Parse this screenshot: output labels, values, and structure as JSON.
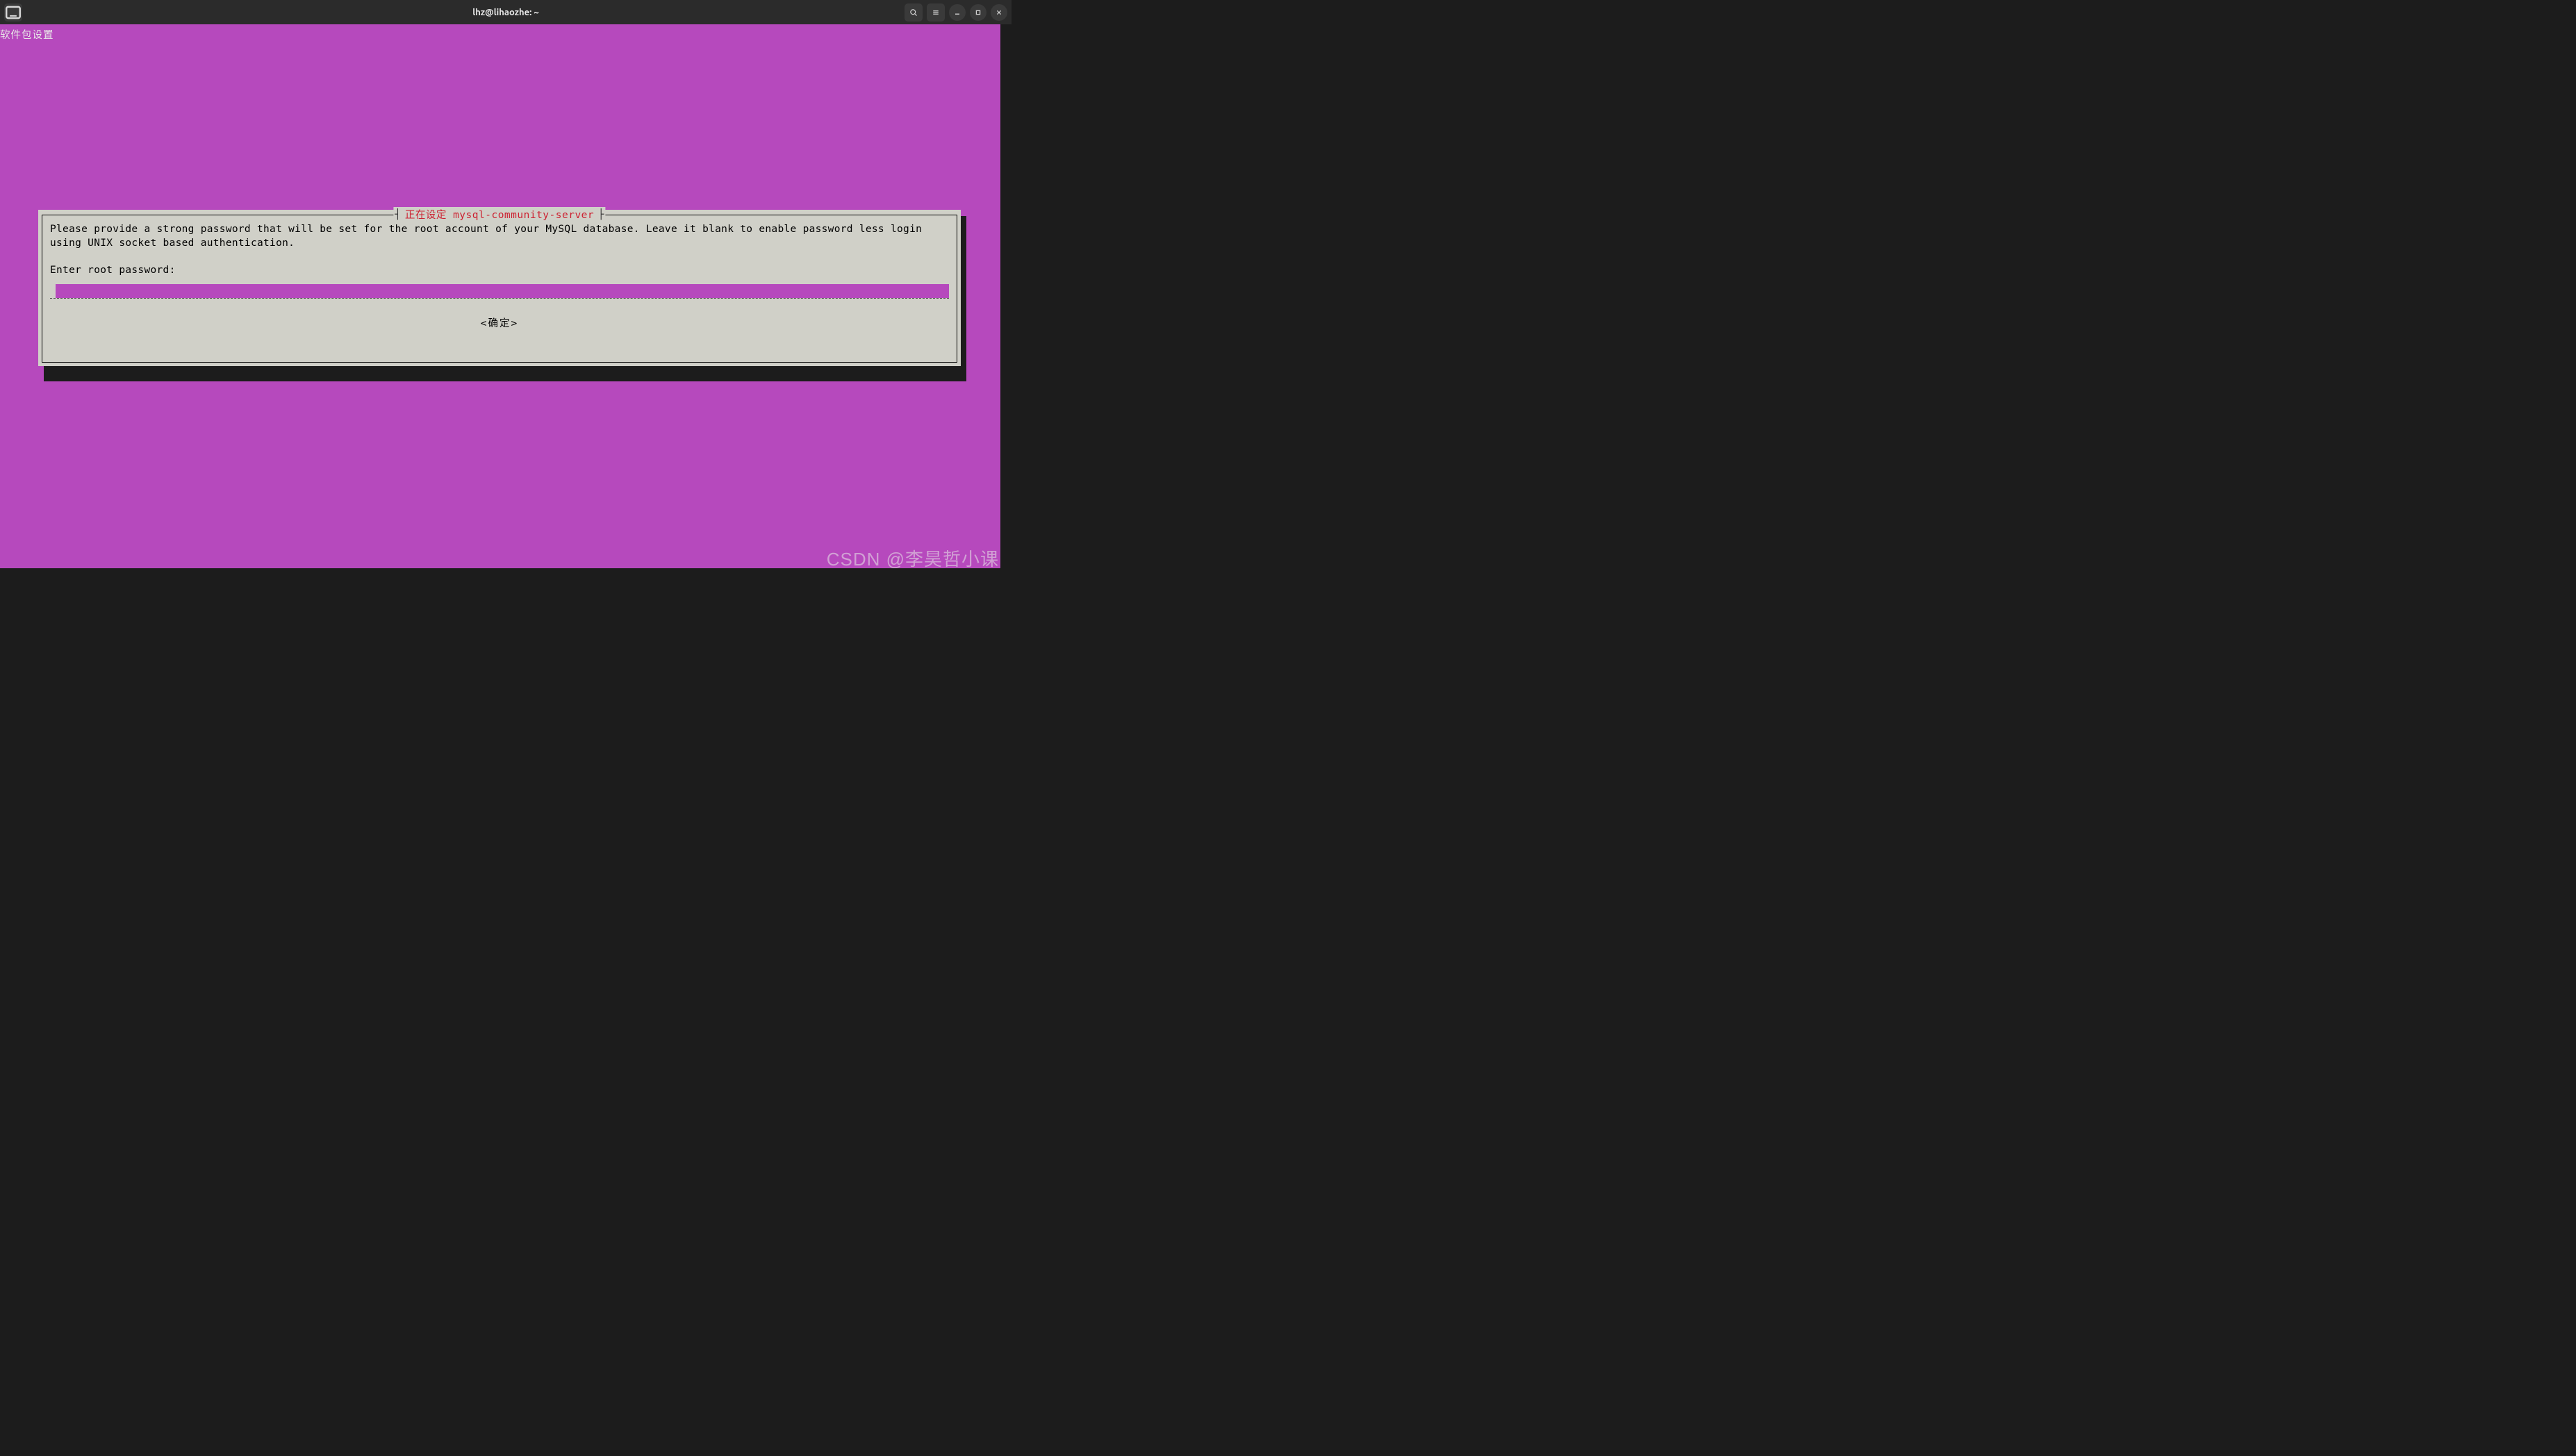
{
  "window": {
    "title": "lhz@lihaozhe: ~"
  },
  "terminal": {
    "config_label": "软件包设置"
  },
  "dialog": {
    "title": "正在设定 mysql-community-server",
    "description": "Please provide a strong password that will be set for the root account of your MySQL database. Leave it blank to enable password less login using UNIX socket based authentication.",
    "prompt": "Enter root password:",
    "input_value": "",
    "confirm_label": "<确定>"
  },
  "watermark": "CSDN @李昊哲小课",
  "colors": {
    "terminal_bg": "#b649bd",
    "dialog_bg": "#d0d0c8",
    "dialog_title_color": "#cc2030",
    "titlebar_bg": "#2b2b2b"
  }
}
